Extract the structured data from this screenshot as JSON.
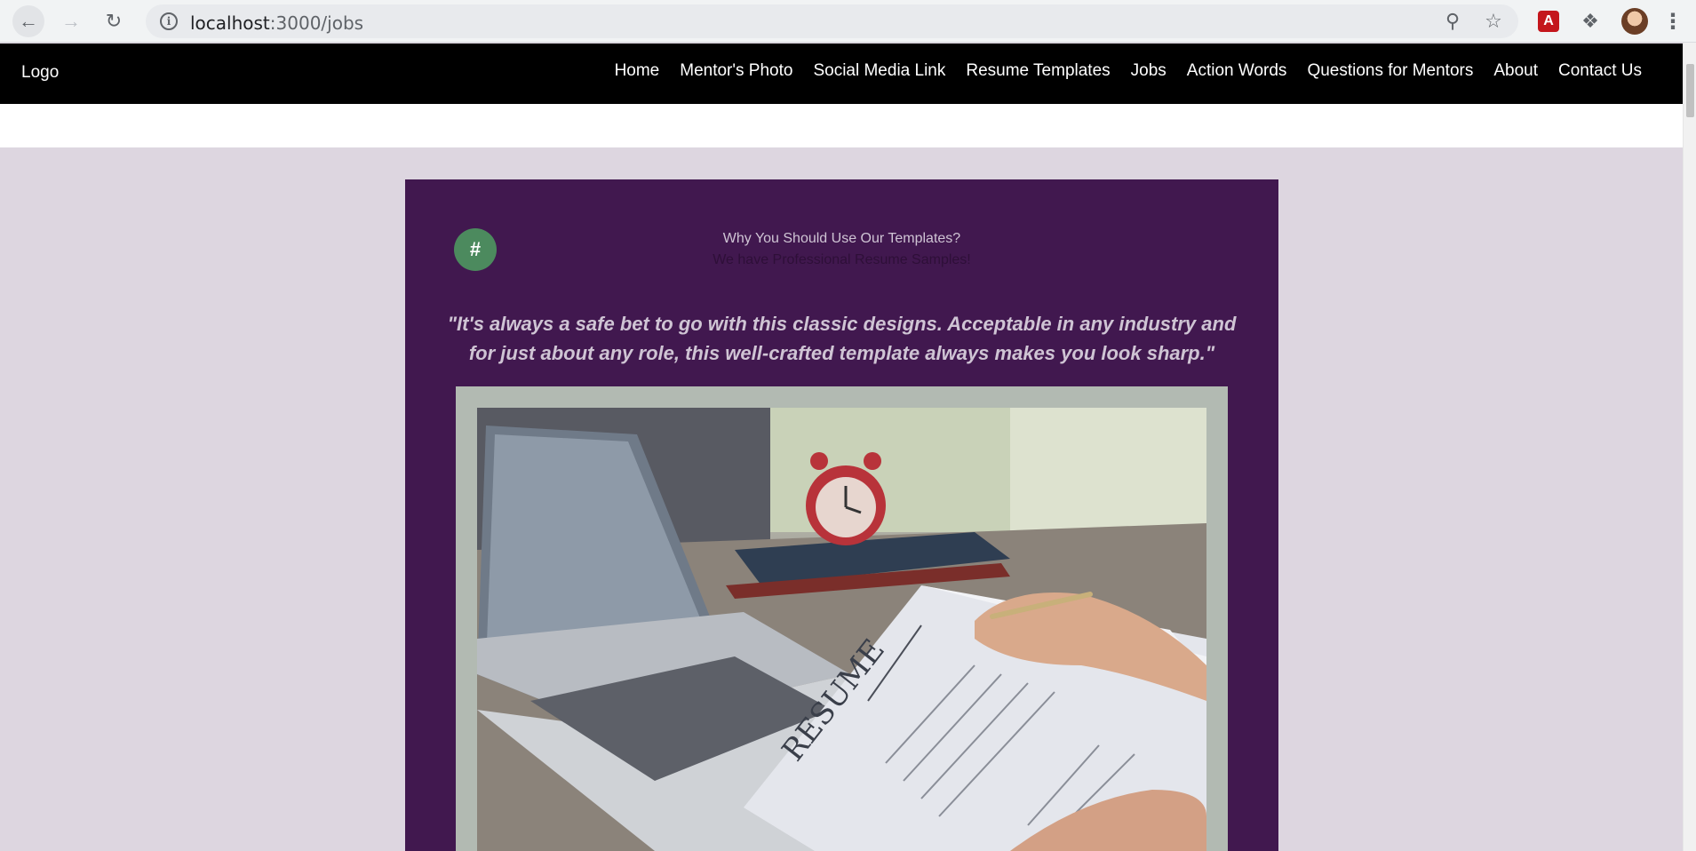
{
  "browser": {
    "url_host": "localhost",
    "url_path": ":3000/jobs",
    "pdf_label": "A"
  },
  "navbar": {
    "logo": "Logo",
    "links": [
      {
        "label": "Home"
      },
      {
        "label": "Mentor's Photo"
      },
      {
        "label": "Social Media Link"
      },
      {
        "label": "Resume Templates"
      },
      {
        "label": "Jobs"
      },
      {
        "label": "Action Words"
      },
      {
        "label": "Questions for Mentors"
      },
      {
        "label": "About"
      },
      {
        "label": "Contact Us"
      }
    ]
  },
  "card": {
    "badge": "#",
    "heading": "Why You Should Use Our Templates?",
    "subheading": "We have Professional Resume Samples!",
    "quote": "\"It's always a safe bet to go with this classic designs. Acceptable in any industry and for just about any role, this well-crafted template always makes you look sharp.\"",
    "photo_text": "RESUME"
  },
  "colors": {
    "navbar_bg": "#000000",
    "page_bg": "#ddd6e0",
    "card_bg": "#41184f",
    "badge_bg": "#4c8a5e",
    "frame_bg": "#b2bab2"
  }
}
